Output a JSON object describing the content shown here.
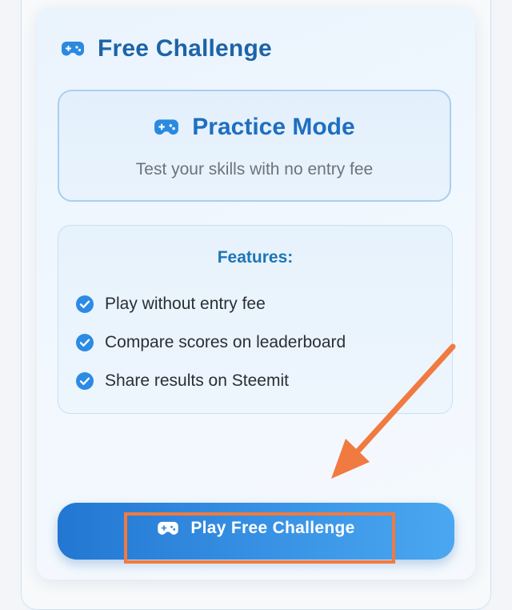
{
  "card": {
    "title": "Free Challenge",
    "icon": "gamepad-icon"
  },
  "practice_mode": {
    "title": "Practice Mode",
    "subtitle": "Test your skills with no entry fee",
    "icon": "gamepad-icon"
  },
  "features": {
    "heading": "Features:",
    "items": [
      {
        "label": "Play without entry fee",
        "icon": "check-circle-icon"
      },
      {
        "label": "Compare scores on leaderboard",
        "icon": "check-circle-icon"
      },
      {
        "label": "Share results on Steemit",
        "icon": "check-circle-icon"
      }
    ]
  },
  "play_button": {
    "label": "Play Free Challenge",
    "icon": "gamepad-icon"
  },
  "colors": {
    "title_blue": "#1d63a8",
    "accent_blue": "#2b8ae0",
    "check_blue": "#2c8be4",
    "annotation_orange": "#f17a40"
  }
}
